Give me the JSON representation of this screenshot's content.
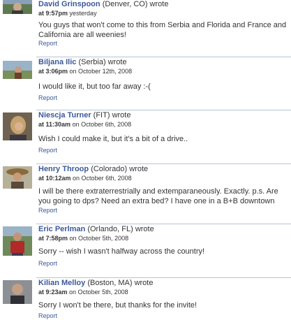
{
  "posts": [
    {
      "author": "David Grinspoon",
      "location": "(Denver, CO)",
      "wrote": "wrote",
      "time": "at 9:57pm",
      "date": "yesterday",
      "message": "You guys that won't come to this from Serbia and Florida and France and California are all weenies!",
      "report": "Report"
    },
    {
      "author": "Biljana Ilic",
      "location": "(Serbia)",
      "wrote": "wrote",
      "time": "at 3:06pm",
      "date": "on October 12th, 2008",
      "message": "I would like it, but too far away :-(",
      "report": "Report"
    },
    {
      "author": "Niescja Turner",
      "location": "(FIT)",
      "wrote": "wrote",
      "time": "at 11:30am",
      "date": "on October 6th, 2008",
      "message": "Wish I could make it, but it's a bit of a drive..",
      "report": "Report"
    },
    {
      "author": "Henry Throop",
      "location": "(Colorado)",
      "wrote": "wrote",
      "time": "at 10:12am",
      "date": "on October 6th, 2008",
      "message": "I will be there extraterrestrially and extemparaneously. Exactly. p.s. Are you going to dps? Need an extra bed? I have one in a B+B downtown",
      "report": "Report"
    },
    {
      "author": "Eric Perlman",
      "location": "(Orlando, FL)",
      "wrote": "wrote",
      "time": "at 7:58pm",
      "date": "on October 5th, 2008",
      "message": "Sorry -- wish I wasn't halfway across the country!",
      "report": "Report"
    },
    {
      "author": "Kilian Melloy",
      "location": "(Boston, MA)",
      "wrote": "wrote",
      "time": "at 9:23am",
      "date": "on October 5th, 2008",
      "message": "Sorry I won't be there, but thanks for the invite!",
      "report": "Report"
    }
  ]
}
